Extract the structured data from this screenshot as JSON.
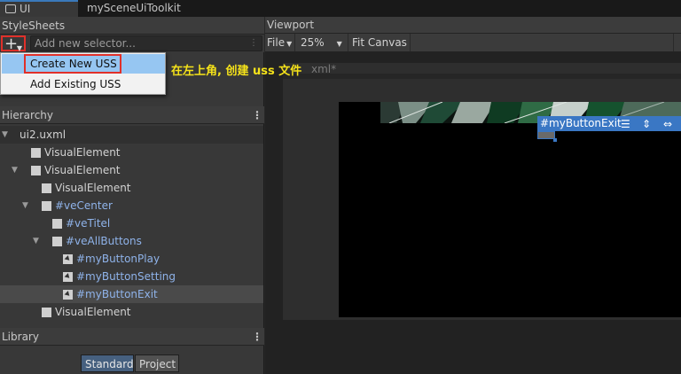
{
  "tabs": {
    "ui_builder": "UI Builder*",
    "scene_toolkit": "mySceneUiToolkit"
  },
  "stylesheets": {
    "header": "StyleSheets",
    "add_button": "+",
    "selector_placeholder": "Add new selector...",
    "menu": {
      "create_new": "Create New USS",
      "add_existing": "Add Existing USS"
    }
  },
  "annotation": "在左上角, 创建 uss 文件",
  "annotation_color": "#f5e21a",
  "hierarchy": {
    "header": "Hierarchy",
    "items": [
      {
        "label": "ui2.uxml"
      },
      {
        "label": "VisualElement"
      },
      {
        "label": "VisualElement"
      },
      {
        "label": "VisualElement"
      },
      {
        "label": "#veCenter"
      },
      {
        "label": "#veTitel"
      },
      {
        "label": "#veAllButtons"
      },
      {
        "label": "#myButtonPlay"
      },
      {
        "label": "#myButtonSetting"
      },
      {
        "label": "#myButtonExit"
      },
      {
        "label": "VisualElement"
      }
    ]
  },
  "library": {
    "header": "Library",
    "tabs": [
      "Standard",
      "Project"
    ]
  },
  "viewport": {
    "header": "Viewport",
    "file_menu": "File",
    "zoom": "25%",
    "fit_canvas": "Fit Canvas",
    "canvas_title": "xml*",
    "selected_badge": "#myButtonExit"
  },
  "colors": {
    "accent": "#3a77c4",
    "highlight_box": "#e0302a",
    "menu_selected": "#96c6f2"
  }
}
